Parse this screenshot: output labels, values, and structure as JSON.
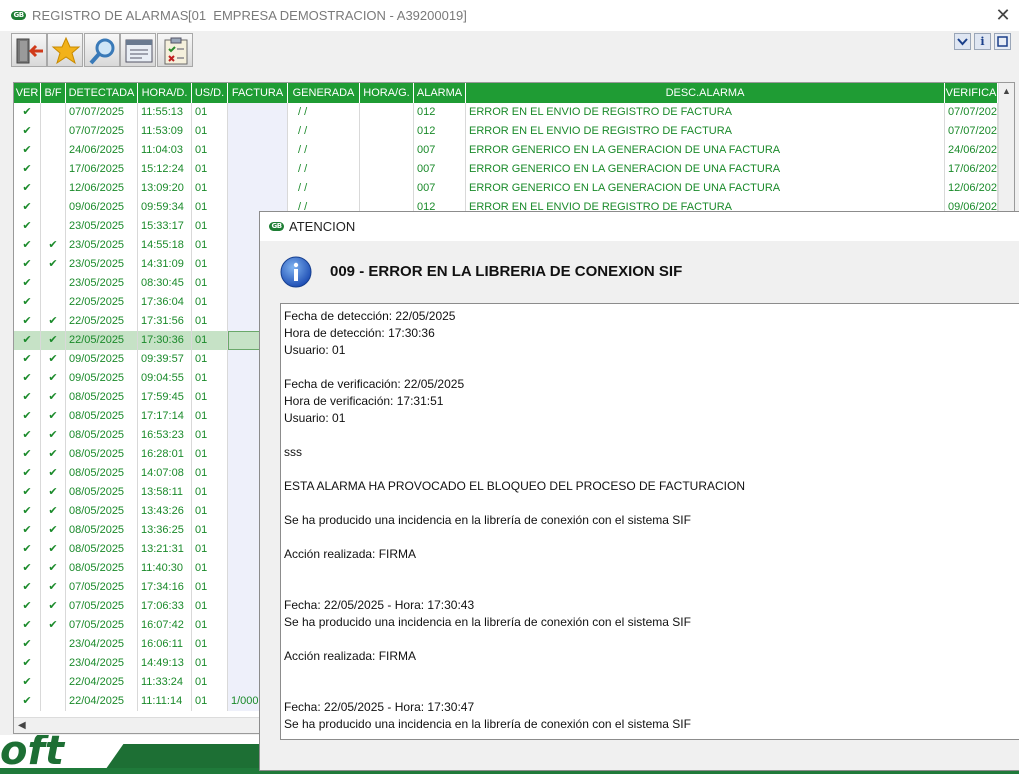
{
  "window": {
    "app_title": "REGISTRO DE ALARMAS",
    "company": "[01  EMPRESA DEMOSTRACION - A39200019]",
    "close_glyph": "✕",
    "logo_text": "GB"
  },
  "toolbar": {
    "buttons": [
      "exit-icon",
      "star-icon",
      "search-icon",
      "form-icon",
      "checklist-icon"
    ],
    "right_buttons": [
      "dropdown-icon",
      "info-icon",
      "window-icon"
    ],
    "info_label": "i"
  },
  "grid": {
    "columns": [
      "VER",
      "B/F",
      "DETECTADA",
      "HORA/D.",
      "US/D.",
      "FACTURA",
      "GENERADA",
      "HORA/G.",
      "ALARMA",
      "DESC.ALARMA",
      "VERIFICA"
    ],
    "check_glyph": "✔",
    "rows": [
      {
        "ver": true,
        "bf": false,
        "detectada": "07/07/2025",
        "hora": "11:55:13",
        "us": "01",
        "factura": "",
        "generada": "/ /",
        "horag": "",
        "alarma": "012",
        "desc": "ERROR EN EL ENVIO DE REGISTRO DE FACTURA",
        "verifica": "07/07/202"
      },
      {
        "ver": true,
        "bf": false,
        "detectada": "07/07/2025",
        "hora": "11:53:09",
        "us": "01",
        "factura": "",
        "generada": "/ /",
        "horag": "",
        "alarma": "012",
        "desc": "ERROR EN EL ENVIO DE REGISTRO DE FACTURA",
        "verifica": "07/07/202"
      },
      {
        "ver": true,
        "bf": false,
        "detectada": "24/06/2025",
        "hora": "11:04:03",
        "us": "01",
        "factura": "",
        "generada": "/ /",
        "horag": "",
        "alarma": "007",
        "desc": "ERROR GENERICO EN LA GENERACION DE UNA FACTURA",
        "verifica": "24/06/202"
      },
      {
        "ver": true,
        "bf": false,
        "detectada": "17/06/2025",
        "hora": "15:12:24",
        "us": "01",
        "factura": "",
        "generada": "/ /",
        "horag": "",
        "alarma": "007",
        "desc": "ERROR GENERICO EN LA GENERACION DE UNA FACTURA",
        "verifica": "17/06/202"
      },
      {
        "ver": true,
        "bf": false,
        "detectada": "12/06/2025",
        "hora": "13:09:20",
        "us": "01",
        "factura": "",
        "generada": "/ /",
        "horag": "",
        "alarma": "007",
        "desc": "ERROR GENERICO EN LA GENERACION DE UNA FACTURA",
        "verifica": "12/06/202"
      },
      {
        "ver": true,
        "bf": false,
        "detectada": "09/06/2025",
        "hora": "09:59:34",
        "us": "01",
        "factura": "",
        "generada": "/ /",
        "horag": "",
        "alarma": "012",
        "desc": "ERROR EN EL ENVIO DE REGISTRO DE FACTURA",
        "verifica": "09/06/202"
      },
      {
        "ver": true,
        "bf": false,
        "detectada": "23/05/2025",
        "hora": "15:33:17",
        "us": "01",
        "factura": "",
        "generada": "",
        "horag": "",
        "alarma": "",
        "desc": "",
        "verifica": ""
      },
      {
        "ver": true,
        "bf": true,
        "detectada": "23/05/2025",
        "hora": "14:55:18",
        "us": "01",
        "factura": "",
        "generada": "",
        "horag": "",
        "alarma": "",
        "desc": "",
        "verifica": ""
      },
      {
        "ver": true,
        "bf": true,
        "detectada": "23/05/2025",
        "hora": "14:31:09",
        "us": "01",
        "factura": "",
        "generada": "",
        "horag": "",
        "alarma": "",
        "desc": "",
        "verifica": ""
      },
      {
        "ver": true,
        "bf": false,
        "detectada": "23/05/2025",
        "hora": "08:30:45",
        "us": "01",
        "factura": "",
        "generada": "",
        "horag": "",
        "alarma": "",
        "desc": "",
        "verifica": ""
      },
      {
        "ver": true,
        "bf": false,
        "detectada": "22/05/2025",
        "hora": "17:36:04",
        "us": "01",
        "factura": "",
        "generada": "",
        "horag": "",
        "alarma": "",
        "desc": "",
        "verifica": ""
      },
      {
        "ver": true,
        "bf": true,
        "detectada": "22/05/2025",
        "hora": "17:31:56",
        "us": "01",
        "factura": "",
        "generada": "",
        "horag": "",
        "alarma": "",
        "desc": "",
        "verifica": ""
      },
      {
        "ver": true,
        "bf": true,
        "detectada": "22/05/2025",
        "hora": "17:30:36",
        "us": "01",
        "factura": "",
        "generada": "",
        "horag": "",
        "alarma": "",
        "desc": "",
        "verifica": "",
        "selected": true
      },
      {
        "ver": true,
        "bf": true,
        "detectada": "09/05/2025",
        "hora": "09:39:57",
        "us": "01",
        "factura": "",
        "generada": "",
        "horag": "",
        "alarma": "",
        "desc": "",
        "verifica": ""
      },
      {
        "ver": true,
        "bf": true,
        "detectada": "09/05/2025",
        "hora": "09:04:55",
        "us": "01",
        "factura": "",
        "generada": "",
        "horag": "",
        "alarma": "",
        "desc": "",
        "verifica": ""
      },
      {
        "ver": true,
        "bf": true,
        "detectada": "08/05/2025",
        "hora": "17:59:45",
        "us": "01",
        "factura": "",
        "generada": "",
        "horag": "",
        "alarma": "",
        "desc": "",
        "verifica": ""
      },
      {
        "ver": true,
        "bf": true,
        "detectada": "08/05/2025",
        "hora": "17:17:14",
        "us": "01",
        "factura": "",
        "generada": "",
        "horag": "",
        "alarma": "",
        "desc": "",
        "verifica": ""
      },
      {
        "ver": true,
        "bf": true,
        "detectada": "08/05/2025",
        "hora": "16:53:23",
        "us": "01",
        "factura": "",
        "generada": "",
        "horag": "",
        "alarma": "",
        "desc": "",
        "verifica": ""
      },
      {
        "ver": true,
        "bf": true,
        "detectada": "08/05/2025",
        "hora": "16:28:01",
        "us": "01",
        "factura": "",
        "generada": "",
        "horag": "",
        "alarma": "",
        "desc": "",
        "verifica": ""
      },
      {
        "ver": true,
        "bf": true,
        "detectada": "08/05/2025",
        "hora": "14:07:08",
        "us": "01",
        "factura": "",
        "generada": "",
        "horag": "",
        "alarma": "",
        "desc": "",
        "verifica": ""
      },
      {
        "ver": true,
        "bf": true,
        "detectada": "08/05/2025",
        "hora": "13:58:11",
        "us": "01",
        "factura": "",
        "generada": "",
        "horag": "",
        "alarma": "",
        "desc": "",
        "verifica": ""
      },
      {
        "ver": true,
        "bf": true,
        "detectada": "08/05/2025",
        "hora": "13:43:26",
        "us": "01",
        "factura": "",
        "generada": "",
        "horag": "",
        "alarma": "",
        "desc": "",
        "verifica": ""
      },
      {
        "ver": true,
        "bf": true,
        "detectada": "08/05/2025",
        "hora": "13:36:25",
        "us": "01",
        "factura": "",
        "generada": "",
        "horag": "",
        "alarma": "",
        "desc": "",
        "verifica": ""
      },
      {
        "ver": true,
        "bf": true,
        "detectada": "08/05/2025",
        "hora": "13:21:31",
        "us": "01",
        "factura": "",
        "generada": "",
        "horag": "",
        "alarma": "",
        "desc": "",
        "verifica": ""
      },
      {
        "ver": true,
        "bf": true,
        "detectada": "08/05/2025",
        "hora": "11:40:30",
        "us": "01",
        "factura": "",
        "generada": "",
        "horag": "",
        "alarma": "",
        "desc": "",
        "verifica": ""
      },
      {
        "ver": true,
        "bf": true,
        "detectada": "07/05/2025",
        "hora": "17:34:16",
        "us": "01",
        "factura": "",
        "generada": "",
        "horag": "",
        "alarma": "",
        "desc": "",
        "verifica": ""
      },
      {
        "ver": true,
        "bf": true,
        "detectada": "07/05/2025",
        "hora": "17:06:33",
        "us": "01",
        "factura": "",
        "generada": "",
        "horag": "",
        "alarma": "",
        "desc": "",
        "verifica": ""
      },
      {
        "ver": true,
        "bf": true,
        "detectada": "07/05/2025",
        "hora": "16:07:42",
        "us": "01",
        "factura": "",
        "generada": "",
        "horag": "",
        "alarma": "",
        "desc": "",
        "verifica": ""
      },
      {
        "ver": true,
        "bf": false,
        "detectada": "23/04/2025",
        "hora": "16:06:11",
        "us": "01",
        "factura": "",
        "generada": "",
        "horag": "",
        "alarma": "",
        "desc": "",
        "verifica": ""
      },
      {
        "ver": true,
        "bf": false,
        "detectada": "23/04/2025",
        "hora": "14:49:13",
        "us": "01",
        "factura": "",
        "generada": "",
        "horag": "",
        "alarma": "",
        "desc": "",
        "verifica": ""
      },
      {
        "ver": true,
        "bf": false,
        "detectada": "22/04/2025",
        "hora": "11:33:24",
        "us": "01",
        "factura": "",
        "generada": "",
        "horag": "",
        "alarma": "",
        "desc": "",
        "verifica": ""
      },
      {
        "ver": true,
        "bf": false,
        "detectada": "22/04/2025",
        "hora": "11:11:14",
        "us": "01",
        "factura": "1/000",
        "generada": "",
        "horag": "",
        "alarma": "",
        "desc": "",
        "verifica": ""
      }
    ]
  },
  "dialog": {
    "title": "ATENCION",
    "heading": "009 - ERROR EN LA LIBRERIA DE CONEXION SIF",
    "lines": [
      "Fecha de detección: 22/05/2025",
      "Hora de detección: 17:30:36",
      "Usuario: 01",
      "",
      "Fecha de verificación: 22/05/2025",
      "Hora de verificación: 17:31:51",
      "Usuario: 01",
      "",
      "sss",
      "",
      "ESTA ALARMA HA PROVOCADO EL BLOQUEO DEL PROCESO DE FACTURACION",
      "",
      "Se ha producido una incidencia en la librería de conexión con el sistema SIF",
      "",
      "Acción realizada: FIRMA",
      "",
      "",
      "Fecha: 22/05/2025 - Hora: 17:30:43",
      "Se ha producido una incidencia en la librería de conexión con el sistema SIF",
      "",
      "Acción realizada: FIRMA",
      "",
      "",
      "Fecha: 22/05/2025 - Hora: 17:30:47",
      "Se ha producido una incidencia en la librería de conexión con el sistema SIF"
    ]
  },
  "desktop": {
    "logo_fragment": "oft"
  },
  "colors": {
    "header_green": "#1f9c34",
    "text_green": "#1a8a2a",
    "selected_row": "#c6e2c6",
    "desktop_green": "#1d6f34"
  }
}
